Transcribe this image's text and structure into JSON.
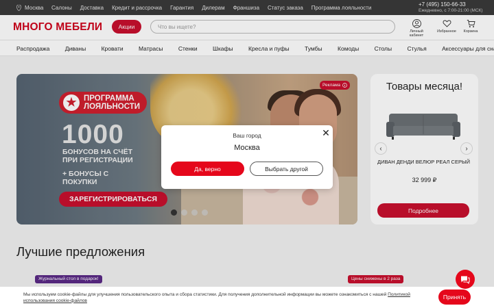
{
  "topbar": {
    "city": "Москва",
    "links": [
      "Салоны",
      "Доставка",
      "Кредит и рассрочка",
      "Гарантия",
      "Дилерам",
      "Франшиза",
      "Статус заказа",
      "Программа лояльности"
    ],
    "phone": "+7 (495) 150-66-33",
    "hours": "Ежедневно, с 7:00-21:00 (МСК)"
  },
  "header": {
    "logo": "МНОГО МЕБЕЛИ",
    "promo_label": "Акции",
    "search_placeholder": "Что вы ищете?",
    "account_label": "Личный кабинет",
    "favorites_label": "Избранное",
    "cart_label": "Корзина"
  },
  "categories": [
    "Распродажа",
    "Диваны",
    "Кровати",
    "Матрасы",
    "Стенки",
    "Шкафы",
    "Кресла и пуфы",
    "Тумбы",
    "Комоды",
    "Столы",
    "Стулья",
    "Аксессуары для сна"
  ],
  "banner": {
    "badge_line1": "ПРОГРАММА",
    "badge_line2": "ЛОЯЛЬНОСТИ",
    "number": "1000",
    "text1": "БОНУСОВ НА СЧЁТ ПРИ РЕГИСТРАЦИИ",
    "text2": "+ БОНУСЫ С ПОКУПКИ",
    "register_label": "ЗАРЕГИСТРИРОВАТЬСЯ",
    "ad_label": "Реклама",
    "slide_count": 4,
    "active_slide": 1
  },
  "month": {
    "title": "Товары месяца!",
    "product_name": "ДИВАН ДЕНДИ ВЕЛЮР РЕАЛ СЕРЫЙ",
    "price": "32 999 ₽",
    "more_label": "Подробнее"
  },
  "best": {
    "title": "Лучшие предложения",
    "tag1": "Журнальный стол в подарок!",
    "tag2": "Цены снижены в 2 раза"
  },
  "city_modal": {
    "label": "Ваш город",
    "city": "Москва",
    "yes_label": "Да, верно",
    "other_label": "Выбрать другой"
  },
  "cookie": {
    "text": "Мы используем cookie-файлы для улучшения пользовательского опыта и сбора статистики. Для получения дополнительной информации вы можете ознакомиться с нашей",
    "link": "Политикой использования cookie-файлов",
    "accept_label": "Принять"
  },
  "colors": {
    "brand_red": "#c8102e",
    "topbar_bg": "#3a3a3a"
  }
}
